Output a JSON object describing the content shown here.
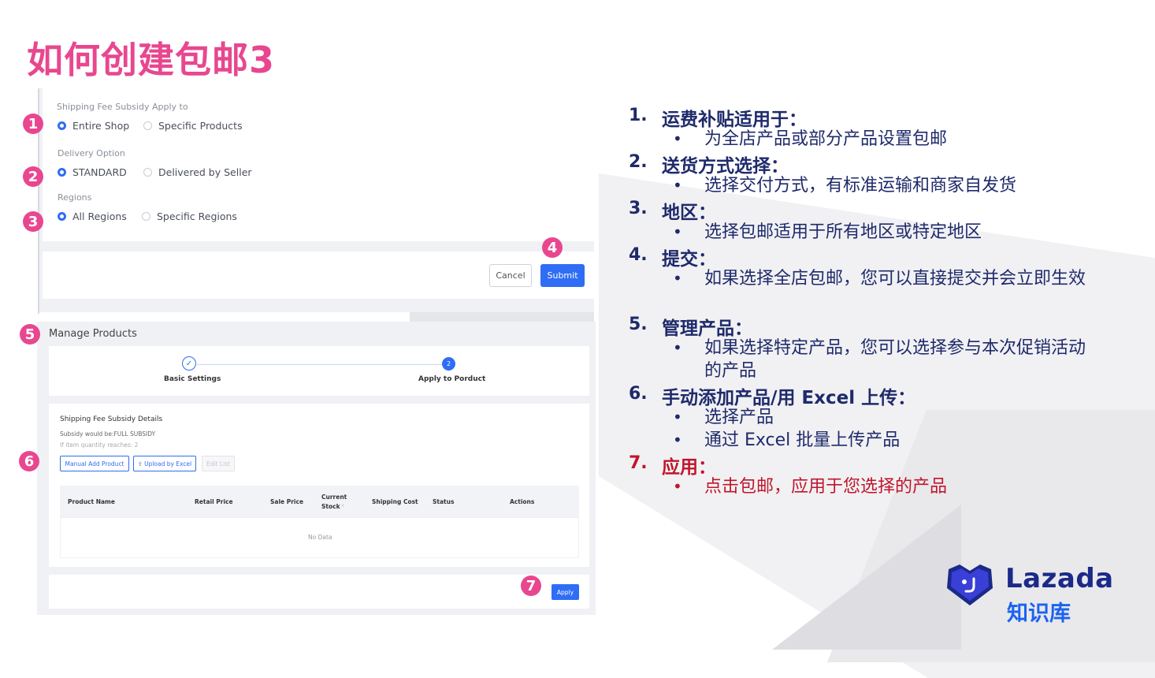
{
  "slide": {
    "title": "如何创建包邮3"
  },
  "form": {
    "subsidy_label": "Shipping Fee Subsidy Apply to",
    "subsidy_options": [
      "Entire Shop",
      "Specific Products"
    ],
    "delivery_label": "Delivery Option",
    "delivery_options": [
      "STANDARD",
      "Delivered by Seller"
    ],
    "regions_label": "Regions",
    "regions_options": [
      "All Regions",
      "Specific Regions"
    ],
    "cancel": "Cancel",
    "submit": "Submit"
  },
  "manage": {
    "title": "Manage Products",
    "step1_label": "Basic Settings",
    "step1_icon": "check-icon",
    "step2_num": "2",
    "step2_label": "Apply to Porduct",
    "details_title": "Shipping Fee Subsidy Details",
    "subsidy_line": "Subsidy would be:FULL SUBSIDY",
    "qty_line": "If item quantity reaches: 2",
    "manual_btn": "Manual Add Product",
    "upload_btn": "Upload by Excel",
    "edit_btn": "Edit List",
    "columns": [
      "Product Name",
      "Retail Price",
      "Sale Price",
      "Current",
      "Stock",
      "Shipping Cost",
      "Status",
      "Actions"
    ],
    "no_data": "No Data",
    "apply": "Apply"
  },
  "badges": [
    "1",
    "2",
    "3",
    "4",
    "5",
    "6",
    "7"
  ],
  "list": [
    {
      "num": "1.",
      "head": "运费补贴适用于：",
      "subs": [
        "为全店产品或部分产品设置包邮"
      ]
    },
    {
      "num": "2.",
      "head": "送货方式选择：",
      "subs": [
        "选择交付方式，有标准运输和商家自发货"
      ]
    },
    {
      "num": "3.",
      "head": "地区：",
      "subs": [
        "选择包邮适用于所有地区或特定地区"
      ]
    },
    {
      "num": "4.",
      "head": "提交：",
      "subs": [
        "如果选择全店包邮，您可以直接提交并会立即生效"
      ]
    },
    {
      "num": "5.",
      "head": "管理产品：",
      "subs": [
        "如果选择特定产品，您可以选择参与本次促销活动的产品"
      ]
    },
    {
      "num": "6.",
      "head": "手动添加产品/用 Excel 上传：",
      "subs": [
        "选择产品",
        "通过 Excel 批量上传产品"
      ]
    },
    {
      "num": "7.",
      "head": "应用：",
      "subs": [
        "点击包邮，应用于您选择的产品"
      ]
    }
  ],
  "bullet_char": "•",
  "logo": {
    "name": "Lazada",
    "sub": "知识库",
    "colors": {
      "navy": "#1b2a88",
      "blue": "#1b63f0"
    }
  },
  "colors": {
    "accent_pink": "#e8478f",
    "primary_blue": "#2f6df5",
    "list_navy": "#1f2a6b",
    "highlight_red": "#c0152b"
  }
}
